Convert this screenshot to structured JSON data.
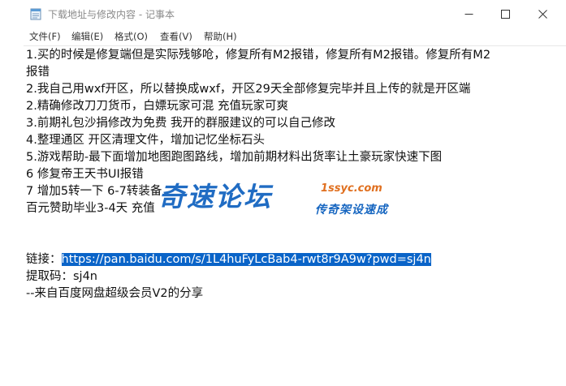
{
  "window": {
    "title": "下载地址与修改内容 - 记事本",
    "icon": "notepad-icon"
  },
  "menubar": {
    "items": [
      {
        "label": "文件(F)"
      },
      {
        "label": "编辑(E)"
      },
      {
        "label": "格式(O)"
      },
      {
        "label": "查看(V)"
      },
      {
        "label": "帮助(H)"
      }
    ]
  },
  "document": {
    "lines": [
      "1.买的时候是修复端但是实际残够呛，修复所有M2报错，修复所有M2报错。修复所有M2",
      "报错",
      "2.我自己用wxf开区，所以替换成wxf，开区29天全部修复完毕并且上传的就是开区端",
      "2.精确修改刀刀货币，白嫖玩家可混 充值玩家可爽",
      "3.前期礼包沙捐修改为免费 我开的群服建议的可以自己修改",
      "4.整理通区 开区清理文件，增加记忆坐标石头",
      "5.游戏帮助-最下面增加地图跑图路线，增加前期材料出货率让土豪玩家快速下图",
      "6 修复帝王天书UI报错",
      "7 增加5转一下 6-7转装备",
      "百元赞助毕业3-4天   充值",
      "",
      "",
      "链接：",
      "提取码：sj4n",
      "--来自百度网盘超级会员V2的分享"
    ],
    "link_label": "链接：",
    "link_url": "https://pan.baidu.com/s/1L4huFyLcBab4-rwt8r9A9w?pwd=sj4n"
  },
  "watermark": {
    "main": "奇速论坛",
    "domain": "1ssyc.com",
    "slogan": "传奇架设速成"
  },
  "colors": {
    "selection": "#0a64c8",
    "watermark_blue": "#1565c0",
    "watermark_orange": "#e07020"
  }
}
